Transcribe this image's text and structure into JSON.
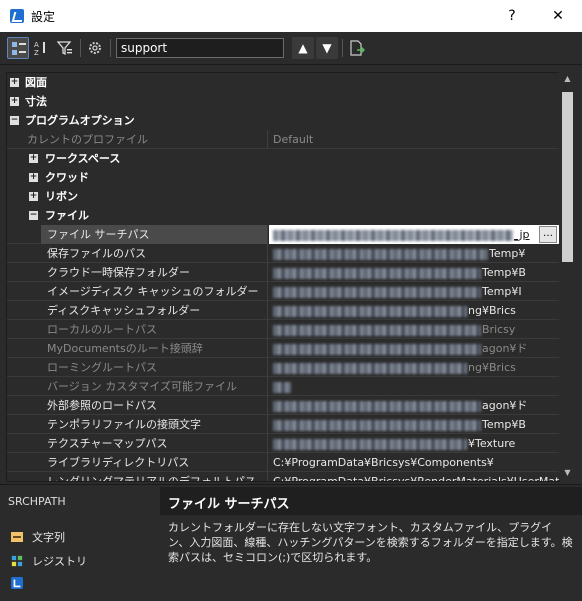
{
  "window": {
    "title": "設定",
    "help_label": "?",
    "close_label": "✕"
  },
  "toolbar": {
    "search_value": "support",
    "up_label": "▲",
    "down_label": "▼"
  },
  "tree": {
    "drawing": "図面",
    "dimension": "寸法",
    "program_options": "プログラムオプション",
    "current_profile_label": "カレントのプロファイル",
    "current_profile_value": "Default",
    "workspace": "ワークスペース",
    "quad": "クワッド",
    "ribbon": "リボン",
    "files": "ファイル"
  },
  "properties": [
    {
      "name": "ファイル サーチパス",
      "value_suffix": "_jp",
      "disabled": false,
      "selected": true
    },
    {
      "name": "保存ファイルのパス",
      "value_suffix": "Temp¥",
      "disabled": false
    },
    {
      "name": "クラウド一時保存フォルダー",
      "value_suffix": "Temp¥B",
      "disabled": false
    },
    {
      "name": "イメージディスク キャッシュのフォルダー",
      "value_suffix": "Temp¥I",
      "disabled": false
    },
    {
      "name": "ディスクキャッシュフォルダー",
      "value_suffix": "ng¥Brics",
      "disabled": false
    },
    {
      "name": "ローカルのルートパス",
      "value_suffix": "Bricsy",
      "disabled": true
    },
    {
      "name": "MyDocumentsのルート接頭辞",
      "value_suffix": "agon¥ド",
      "disabled": true
    },
    {
      "name": "ローミングルートパス",
      "value_suffix": "ng¥Brics",
      "disabled": true
    },
    {
      "name": "バージョン カスタマイズ可能ファイル",
      "value_suffix": "",
      "disabled": true
    },
    {
      "name": "外部参照のロードパス",
      "value_suffix": "agon¥ド",
      "disabled": false
    },
    {
      "name": "テンポラリファイルの接頭文字",
      "value_suffix": "Temp¥B",
      "disabled": false
    },
    {
      "name": "テクスチャーマップパス",
      "value_suffix": "¥Texture",
      "disabled": false
    },
    {
      "name": "ライブラリディレクトリパス",
      "value": "C:¥ProgramData¥Bricsys¥Components¥",
      "disabled": false
    },
    {
      "name": "レンダリングマテリアルのデフォルトパス",
      "value": "C:¥ProgramData¥Bricsys¥RenderMaterials¥UserMateria",
      "disabled": false
    }
  ],
  "bottom": {
    "variable_name": "SRCHPATH",
    "title": "ファイル サーチパス",
    "description": "カレントフォルダーに存在しない文字フォント、カスタムファイル、プラグイン、入力図面、線種、ハッチングパターンを検索するフォルダーを指定します。検索パスは、セミコロン(;)で区切られます。",
    "legend_string": "文字列",
    "legend_registry": "レジストリ"
  },
  "colors": {
    "accent": "#1f6fd1",
    "selection": "#4a4a4a",
    "panel": "#2b2b2b"
  }
}
